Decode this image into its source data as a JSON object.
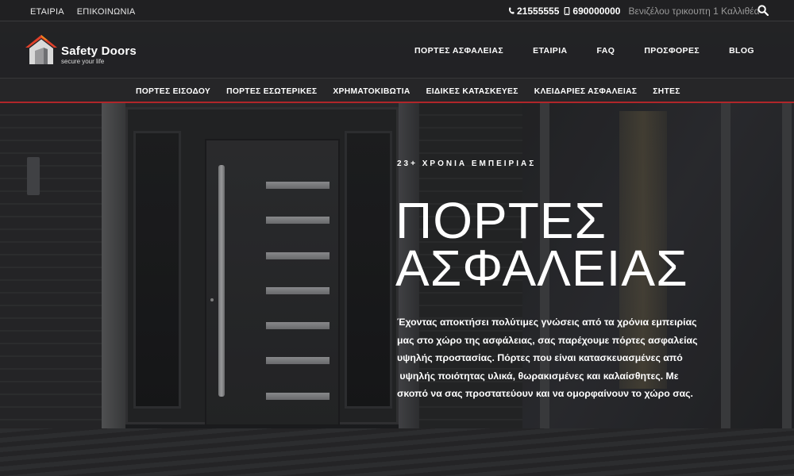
{
  "topbar": {
    "links": [
      "ΕΤΑΙΡΙΑ",
      "ΕΠΙΚΟΙΝΩΝΙΑ"
    ],
    "phone": "21555555",
    "mobile": "690000000",
    "address": "Βενιζέλου τρικουπη 1 Καλλιθέα",
    "icons": [
      "phone-icon",
      "mobile-icon",
      "search-icon"
    ]
  },
  "logo": {
    "name": "Safety Doors",
    "tagline": "secure your life",
    "colors": {
      "roof": "#e0402a",
      "roof_accent": "#f08a1c",
      "house": "#d9d9d9"
    }
  },
  "mainnav": {
    "items": [
      "ΠΟΡΤΕΣ ΑΣΦΑΛΕΙΑΣ",
      "ΕΤΑΙΡΙΑ",
      "FAQ",
      "ΠΡΟΣΦΟΡΕΣ",
      "BLOG"
    ]
  },
  "subnav": {
    "items": [
      "ΠΟΡΤΕΣ ΕΙΣΟΔΟΥ",
      "ΠΟΡΤΕΣ ΕΣΩΤΕΡΙΚΕΣ",
      "ΧΡΗΜΑΤΟΚΙΒΩΤΙΑ",
      "ΕΙΔΙΚΕΣ ΚΑΤΑΣΚΕΥΕΣ",
      "ΚΛΕΙΔΑΡΙΕΣ ΑΣΦΑΛΕΙΑΣ",
      "ΣΗΤΕΣ"
    ],
    "accent_color": "#b0262a"
  },
  "hero": {
    "eyebrow": "23+ ΧΡΟΝΙΑ ΕΜΠΕΙΡΙΑΣ",
    "title_line1": "ΠΟΡΤΕΣ",
    "title_line2": "ΑΣΦΑΛΕΙΑΣ",
    "body_lines": [
      "Έχοντας αποκτήσει πολύτιμες γνώσεις από τα χρόνια εμπειρίας",
      "μας στο χώρο της ασφάλειας, σας παρέχουμε πόρτες ασφαλείας",
      "υψηλής προστασίας. Πόρτες που είναι κατασκευασμένες από",
      " υψηλής ποιότητας υλικά, θωρακισμένες και καλαίσθητες. Με",
      "σκοπό να σας προστατεύουν και να ομορφαίνουν το χώρο σας."
    ]
  }
}
